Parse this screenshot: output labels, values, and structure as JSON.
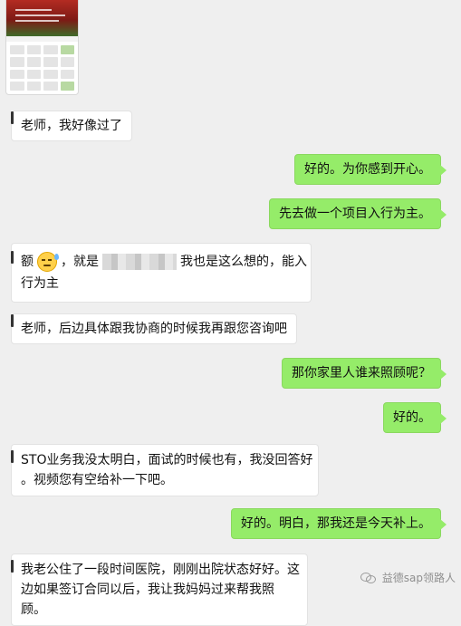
{
  "messages": [
    {
      "side": "in",
      "text": "老师，我好像过了"
    },
    {
      "side": "out",
      "text": "好的。为你感到开心。"
    },
    {
      "side": "out",
      "text": "先去做一个项目入行为主。"
    },
    {
      "side": "in",
      "parts": [
        "额",
        "，就是",
        "我也是这么想的，能入"
      ],
      "line2": "行为主"
    },
    {
      "side": "in",
      "text": "老师，后边具体跟我协商的时候我再跟您咨询吧"
    },
    {
      "side": "out",
      "text": "那你家里人谁来照顾呢？"
    },
    {
      "side": "out",
      "text": "好的。"
    },
    {
      "side": "in",
      "line1": "STO业务我没太明白，面试的时候也有，我没回答好",
      "line2": "。视频您有空给补一下吧。"
    },
    {
      "side": "out",
      "text": "好的。明白，那我还是今天补上。"
    },
    {
      "side": "in",
      "line1": "我老公住了一段时间医院，刚刚出院状态好好。这",
      "line2": "边如果签订合同以后，我让我妈妈过来帮我照顾。"
    }
  ],
  "watermark": {
    "text": "益德sap领路人",
    "icon": "wechat-channel-icon"
  },
  "colors": {
    "out_bubble": "#95ec69",
    "in_bubble": "#ffffff",
    "background": "#efefef"
  }
}
